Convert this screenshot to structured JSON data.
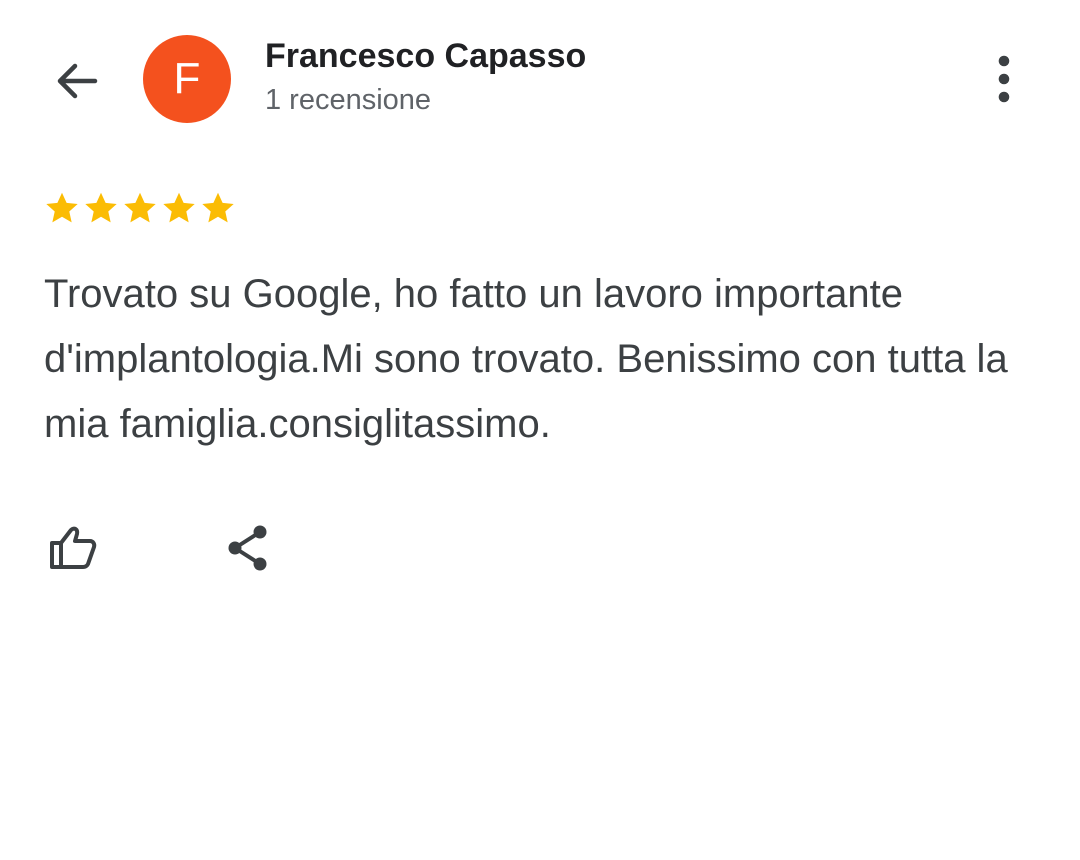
{
  "header": {
    "back_icon": "arrow-left-icon",
    "avatar": {
      "letter": "F",
      "color": "#f4511e"
    },
    "user_name": "Francesco Capasso",
    "review_count": "1 recensione",
    "more_icon": "more-vertical-icon"
  },
  "review": {
    "rating": 5,
    "max_rating": 5,
    "star_color": "#fbbc04",
    "text": "Trovato su Google, ho fatto un lavoro importante d'implantologia.Mi sono trovato. Benissimo con tutta la mia famiglia.consiglitassimo."
  },
  "actions": {
    "like_icon": "thumb-up-icon",
    "share_icon": "share-icon"
  },
  "colors": {
    "icon_gray": "#3c4043",
    "text_primary": "#202124",
    "text_secondary": "#5f6368"
  }
}
